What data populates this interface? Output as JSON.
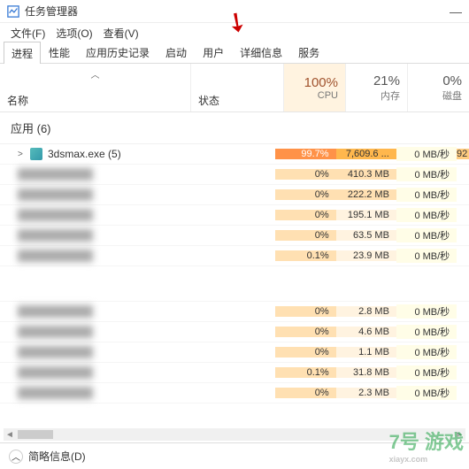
{
  "window": {
    "title": "任务管理器",
    "minimize": "—",
    "close": "×"
  },
  "menu": {
    "file": "文件(F)",
    "options": "选项(O)",
    "view": "查看(V)"
  },
  "tabs": {
    "processes": "进程",
    "performance": "性能",
    "history": "应用历史记录",
    "startup": "启动",
    "users": "用户",
    "details": "详细信息",
    "services": "服务"
  },
  "columns": {
    "name": "名称",
    "status": "状态",
    "cpu": {
      "pct": "100%",
      "label": "CPU"
    },
    "memory": {
      "pct": "21%",
      "label": "内存"
    },
    "disk": {
      "pct": "0%",
      "label": "磁盘"
    }
  },
  "section": {
    "apps": "应用 (6)"
  },
  "rows": [
    {
      "name": "3dsmax.exe (5)",
      "cpu": "99.7%",
      "mem": "7,609.6 ...",
      "disk": "0 MB/秒",
      "oth": "92",
      "cpu_cls": "h1",
      "mem_cls": "h1",
      "expandable": true,
      "icon": true
    },
    {
      "blur": true,
      "cpu": "0%",
      "mem": "410.3 MB",
      "disk": "0 MB/秒",
      "cpu_cls": "h0",
      "mem_cls": "h2"
    },
    {
      "blur": true,
      "cpu": "0%",
      "mem": "222.2 MB",
      "disk": "0 MB/秒",
      "cpu_cls": "h0",
      "mem_cls": "h2"
    },
    {
      "blur": true,
      "cpu": "0%",
      "mem": "195.1 MB",
      "disk": "0 MB/秒",
      "cpu_cls": "h0",
      "mem_cls": "h3"
    },
    {
      "blur": true,
      "cpu": "0%",
      "mem": "63.5 MB",
      "disk": "0 MB/秒",
      "cpu_cls": "h0",
      "mem_cls": "h3"
    },
    {
      "blur": true,
      "cpu": "0.1%",
      "mem": "23.9 MB",
      "disk": "0 MB/秒",
      "cpu_cls": "h0",
      "mem_cls": "h3"
    },
    {
      "gap": true
    },
    {
      "blur": true,
      "cpu": "0%",
      "mem": "2.8 MB",
      "disk": "0 MB/秒",
      "cpu_cls": "h0",
      "mem_cls": "h3"
    },
    {
      "blur": true,
      "cpu": "0%",
      "mem": "4.6 MB",
      "disk": "0 MB/秒",
      "cpu_cls": "h0",
      "mem_cls": "h3"
    },
    {
      "blur": true,
      "cpu": "0%",
      "mem": "1.1 MB",
      "disk": "0 MB/秒",
      "cpu_cls": "h0",
      "mem_cls": "h3"
    },
    {
      "blur": true,
      "cpu": "0.1%",
      "mem": "31.8 MB",
      "disk": "0 MB/秒",
      "cpu_cls": "h0",
      "mem_cls": "h3"
    },
    {
      "blur": true,
      "cpu": "0%",
      "mem": "2.3 MB",
      "disk": "0 MB/秒",
      "cpu_cls": "h0",
      "mem_cls": "h3"
    }
  ],
  "footer": {
    "brief": "简略信息(D)"
  },
  "watermark": {
    "main": "7号 游戏",
    "sub": "xiayx.com"
  }
}
